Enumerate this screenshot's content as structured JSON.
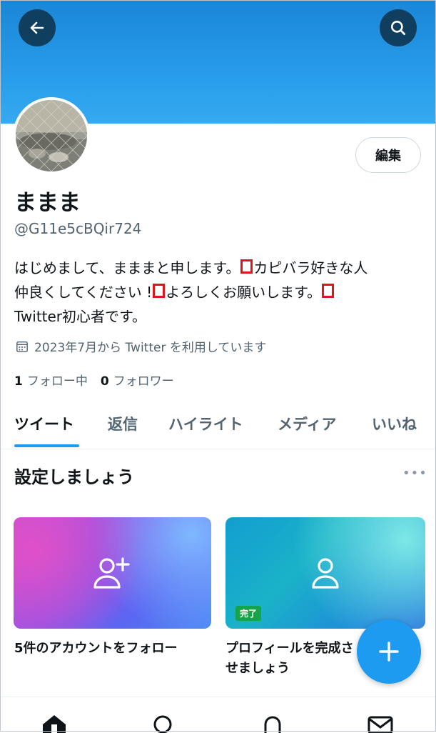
{
  "profile": {
    "display_name": "ままま",
    "handle": "@G11e5cBQir724",
    "edit_label": "編集",
    "bio": {
      "line1_a": "はじめまして、まままと申します。",
      "line1_b": "カピバラ好きな人",
      "line2_a": "仲良くしてください !",
      "line2_b": "よろしくお願いします。",
      "line3": "Twitter初心者です。"
    },
    "joined": "2023年7月から Twitter を利用しています",
    "following_count": "1",
    "following_label": "フォロー中",
    "followers_count": "0",
    "followers_label": "フォロワー"
  },
  "tabs": [
    {
      "label": "ツイート",
      "active": true
    },
    {
      "label": "返信"
    },
    {
      "label": "ハイライト"
    },
    {
      "label": "メディア"
    },
    {
      "label": "いいね"
    }
  ],
  "setup": {
    "title": "設定しましょう",
    "more": "•••",
    "cards": [
      {
        "label": "5件のアカウントをフォロー",
        "icon": "add-person-icon"
      },
      {
        "label": "プロフィールを完成させましょう",
        "badge": "完了",
        "icon": "person-icon"
      }
    ]
  },
  "icons": {
    "back": "arrow-left-icon",
    "search": "search-icon",
    "fab": "plus-icon",
    "nav": [
      "home-icon",
      "search-icon",
      "bell-icon",
      "mail-icon"
    ]
  },
  "colors": {
    "accent": "#1d9bf0",
    "banner": "#2aa0ec",
    "text": "#0f1419",
    "muted": "#536471",
    "badge": "#16a34a"
  }
}
